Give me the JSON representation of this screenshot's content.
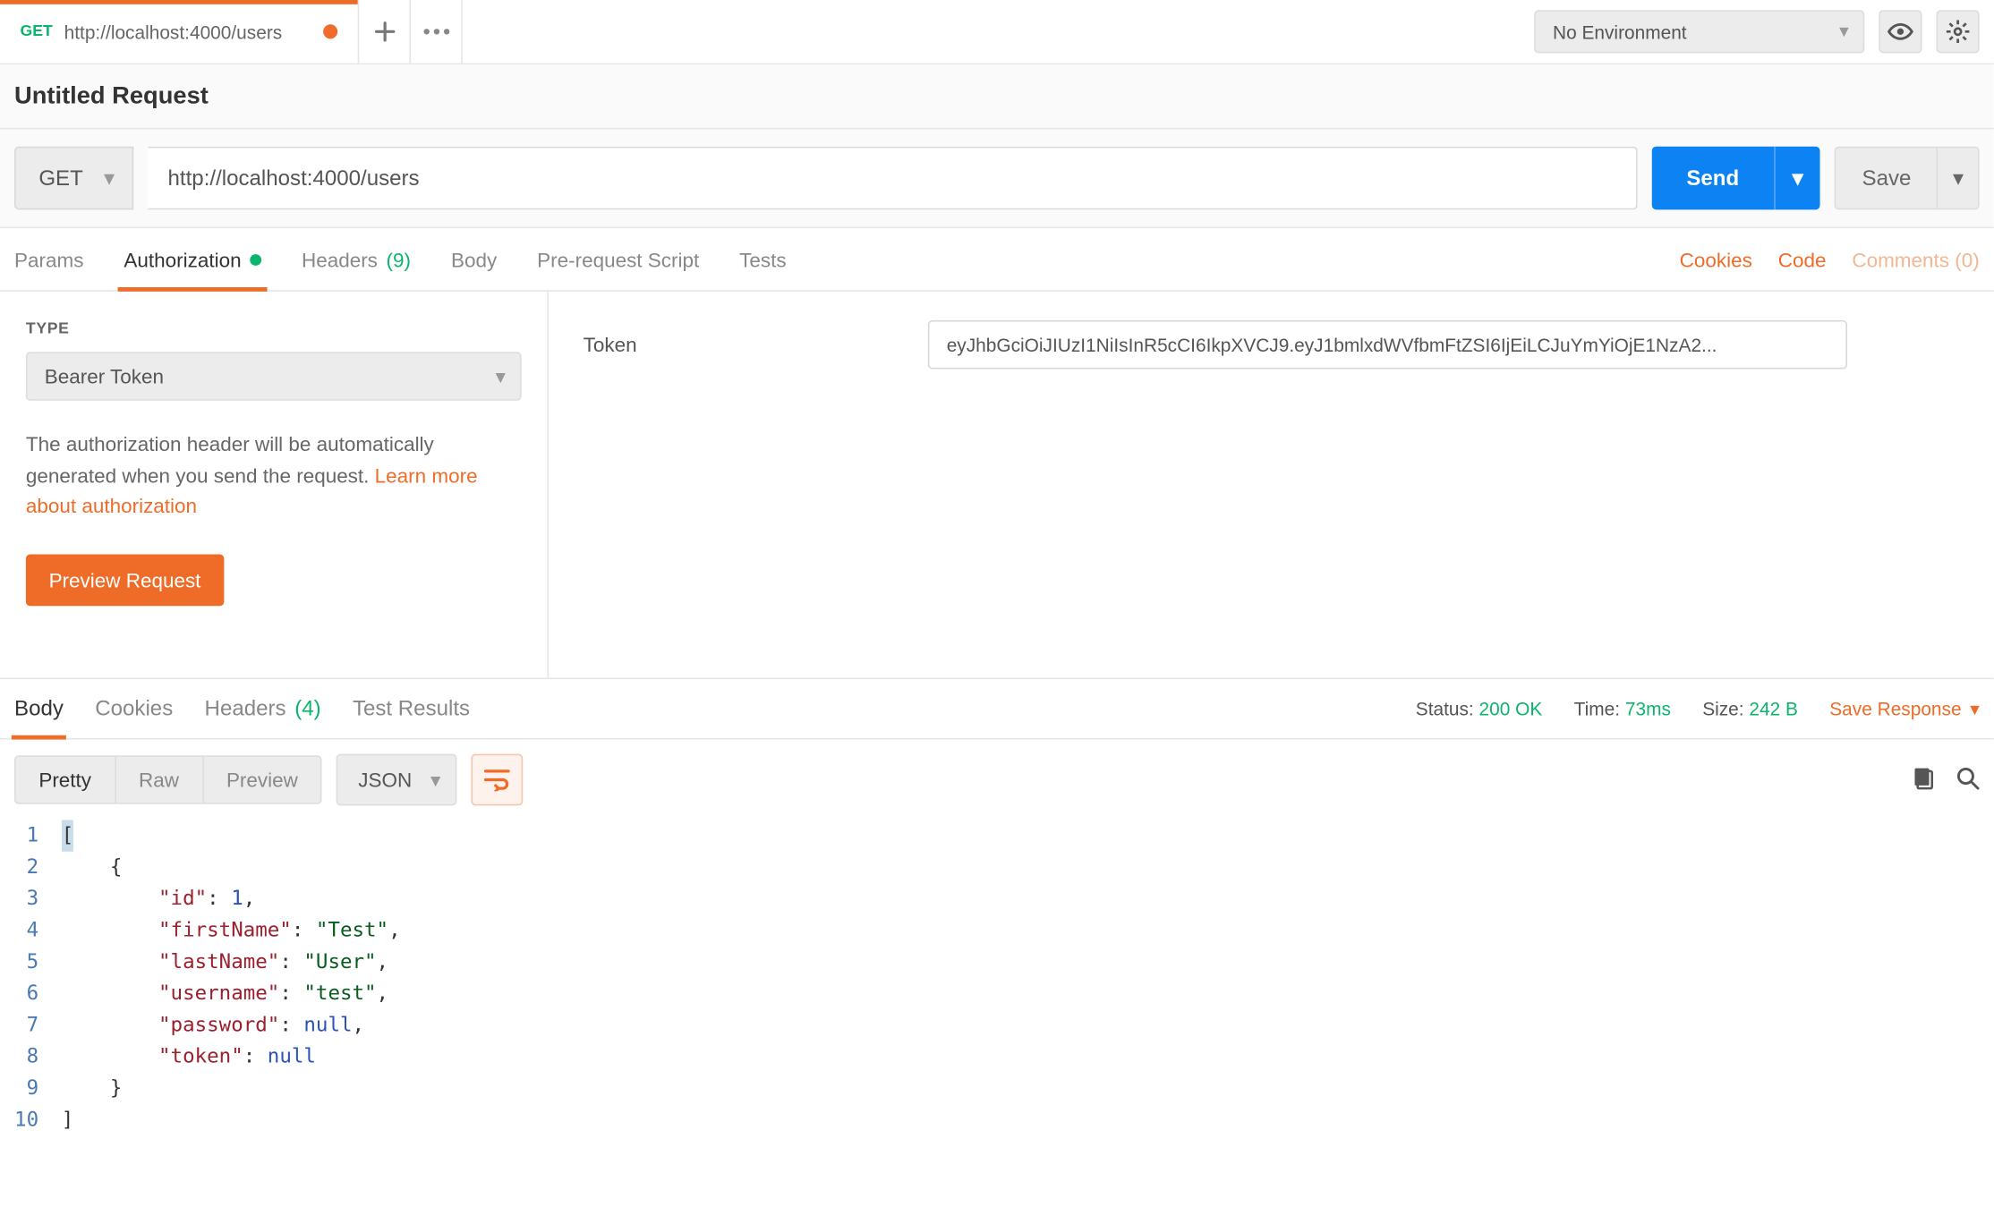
{
  "tab": {
    "method": "GET",
    "title": "http://localhost:4000/users"
  },
  "env": {
    "label": "No Environment"
  },
  "request": {
    "name": "Untitled Request",
    "method": "GET",
    "url": "http://localhost:4000/users",
    "send": "Send",
    "save": "Save"
  },
  "reqTabs": {
    "params": "Params",
    "auth": "Authorization",
    "headers": "Headers",
    "headersCount": "(9)",
    "body": "Body",
    "prereq": "Pre-request Script",
    "tests": "Tests"
  },
  "reqLinks": {
    "cookies": "Cookies",
    "code": "Code",
    "comments": "Comments (0)"
  },
  "auth": {
    "typeLabel": "TYPE",
    "type": "Bearer Token",
    "help1": "The authorization header will be automatically generated when you send the request. ",
    "helpLink": "Learn more about authorization",
    "preview": "Preview Request",
    "tokenLabel": "Token",
    "tokenValue": "eyJhbGciOiJIUzI1NiIsInR5cCI6IkpXVCJ9.eyJ1bmlxdWVfbmFtZSI6IjEiLCJuYmYiOjE1NzA2..."
  },
  "respTabs": {
    "body": "Body",
    "cookies": "Cookies",
    "headers": "Headers",
    "headersCount": "(4)",
    "tests": "Test Results"
  },
  "respMeta": {
    "statusLabel": "Status:",
    "status": "200 OK",
    "timeLabel": "Time:",
    "time": "73ms",
    "sizeLabel": "Size:",
    "size": "242 B",
    "save": "Save Response"
  },
  "respToolbar": {
    "pretty": "Pretty",
    "raw": "Raw",
    "preview": "Preview",
    "format": "JSON"
  },
  "respBody": {
    "lines": [
      "1",
      "2",
      "3",
      "4",
      "5",
      "6",
      "7",
      "8",
      "9",
      "10"
    ],
    "obj": {
      "id_key": "\"id\"",
      "id_val": "1",
      "firstName_key": "\"firstName\"",
      "firstName_val": "\"Test\"",
      "lastName_key": "\"lastName\"",
      "lastName_val": "\"User\"",
      "username_key": "\"username\"",
      "username_val": "\"test\"",
      "password_key": "\"password\"",
      "password_val": "null",
      "token_key": "\"token\"",
      "token_val": "null"
    }
  }
}
